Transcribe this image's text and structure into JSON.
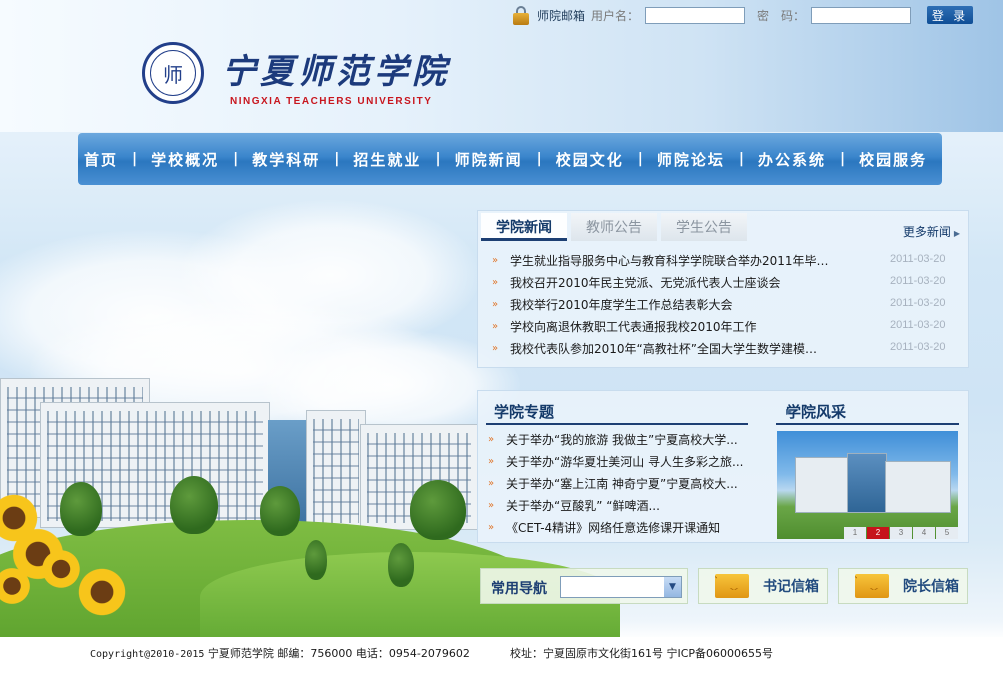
{
  "login": {
    "mailbox_label": "师院邮箱",
    "username_label": "用户名：",
    "password_label": "密　码：",
    "username_value": "",
    "password_value": "",
    "button_label": "登 录"
  },
  "logo": {
    "title_cn": "宁夏师范学院",
    "title_en": "NINGXIA TEACHERS UNIVERSITY",
    "seal_glyph": "师"
  },
  "nav": {
    "items": [
      "首页",
      "学校概况",
      "教学科研",
      "招生就业",
      "师院新闻",
      "校园文化",
      "师院论坛",
      "办公系统",
      "校园服务"
    ]
  },
  "news": {
    "tabs": [
      "学院新闻",
      "教师公告",
      "学生公告"
    ],
    "active_tab": "学院新闻",
    "more_label": "更多新闻",
    "items": [
      {
        "title": "学生就业指导服务中心与教育科学学院联合举办2011年毕…",
        "date": "2011-03-20"
      },
      {
        "title": "我校召开2010年民主党派、无党派代表人士座谈会",
        "date": "2011-03-20"
      },
      {
        "title": "我校举行2010年度学生工作总结表彰大会",
        "date": "2011-03-20"
      },
      {
        "title": "学校向离退休教职工代表通报我校2010年工作",
        "date": "2011-03-20"
      },
      {
        "title": "我校代表队参加2010年“高教社杯”全国大学生数学建模…",
        "date": "2011-03-20"
      }
    ]
  },
  "topics": {
    "heading": "学院专题",
    "items": [
      "关于举办“我的旅游 我做主”宁夏高校大学...",
      "关于举办“游华夏壮美河山 寻人生多彩之旅...",
      "关于举办“塞上江南 神奇宁夏”宁夏高校大...",
      "关于举办“豆酸乳” “鲜啤酒...",
      "《CET-4精讲》网络任意选修课开课通知"
    ]
  },
  "style": {
    "heading": "学院风采",
    "pages": [
      "1",
      "2",
      "3",
      "4",
      "5"
    ],
    "active_page": "2"
  },
  "quick_nav": {
    "label": "常用导航",
    "selected": ""
  },
  "mailboxes": {
    "secretary": "书记信箱",
    "president": "院长信箱"
  },
  "footer": {
    "copyright_prefix": "Copyright@2010-2015",
    "copyright_rest": "宁夏师范学院 邮编：756000 电话：0954-2079602",
    "address": "校址：宁夏固原市文化街161号 宁ICP备06000655号"
  },
  "colors": {
    "nav_blue": "#3b86cc",
    "heading_navy": "#143a6a",
    "accent_red": "#c6141b",
    "bullet_orange": "#e0772c"
  }
}
